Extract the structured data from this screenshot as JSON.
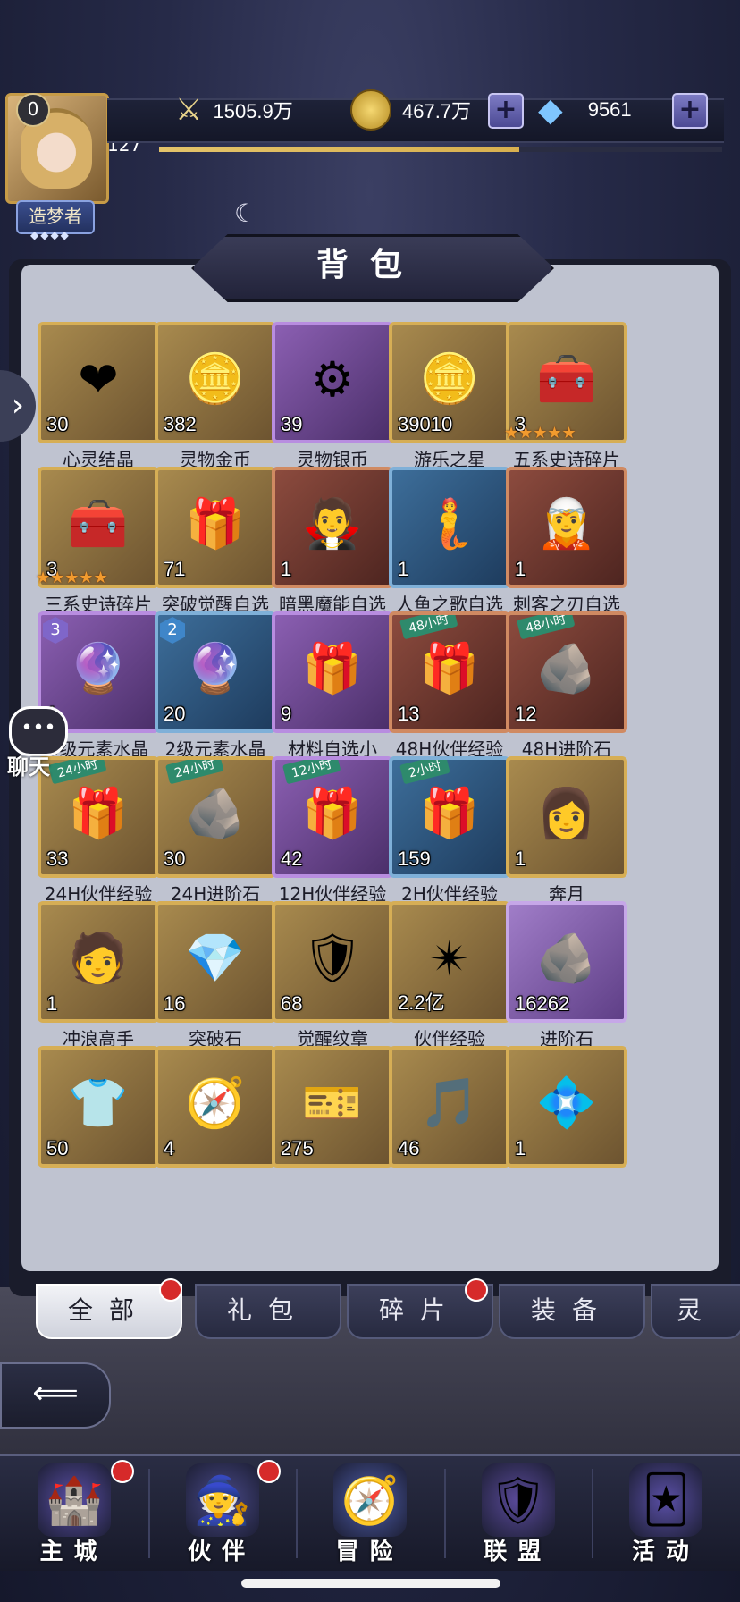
{
  "player": {
    "level_badge": "0",
    "level": "127",
    "title": "造梦者",
    "title_stars": "◆◆◆◆",
    "xp_fraction": 0.64
  },
  "resources": {
    "power": "1505.9万",
    "gold": "467.7万",
    "diamond": "9561"
  },
  "panel": {
    "title": "背包"
  },
  "items": [
    {
      "name": "心灵结晶",
      "qty": "30",
      "frame": "gold",
      "icon": "❤"
    },
    {
      "name": "灵物金币",
      "qty": "382",
      "frame": "gold",
      "icon": "🪙"
    },
    {
      "name": "灵物银币",
      "qty": "39",
      "frame": "purple",
      "icon": "⚙"
    },
    {
      "name": "游乐之星",
      "qty": "39010",
      "frame": "gold",
      "icon": "🪙"
    },
    {
      "name": "五系史诗碎片",
      "qty": "3",
      "frame": "gold",
      "icon": "🧰",
      "stars": "★★★★★"
    },
    {
      "name": "三系史诗碎片",
      "qty": "3",
      "frame": "gold",
      "icon": "🧰",
      "stars": "★★★★★"
    },
    {
      "name": "突破觉醒自选",
      "qty": "71",
      "frame": "gold",
      "icon": "🎁"
    },
    {
      "name": "暗黑魔能自选",
      "qty": "1",
      "frame": "red",
      "icon": "🧛"
    },
    {
      "name": "人鱼之歌自选",
      "qty": "1",
      "frame": "blue",
      "icon": "🧜"
    },
    {
      "name": "刺客之刃自选",
      "qty": "1",
      "frame": "red",
      "icon": "🧝"
    },
    {
      "name": "3级元素水晶",
      "qty": "1",
      "frame": "purple",
      "icon": "🔮",
      "tier": "3"
    },
    {
      "name": "2级元素水晶",
      "qty": "20",
      "frame": "blue",
      "icon": "🔮",
      "tier": "2"
    },
    {
      "name": "材料自选小",
      "qty": "9",
      "frame": "purple",
      "icon": "🎁"
    },
    {
      "name": "48H伙伴经验",
      "qty": "13",
      "frame": "red",
      "icon": "🎁",
      "tag": "48小时"
    },
    {
      "name": "48H进阶石",
      "qty": "12",
      "frame": "red",
      "icon": "🪨",
      "tag": "48小时"
    },
    {
      "name": "24H伙伴经验",
      "qty": "33",
      "frame": "gold",
      "icon": "🎁",
      "tag": "24小时"
    },
    {
      "name": "24H进阶石",
      "qty": "30",
      "frame": "gold",
      "icon": "🪨",
      "tag": "24小时"
    },
    {
      "name": "12H伙伴经验",
      "qty": "42",
      "frame": "purple",
      "icon": "🎁",
      "tag": "12小时"
    },
    {
      "name": "2H伙伴经验",
      "qty": "159",
      "frame": "blue",
      "icon": "🎁",
      "tag": "2小时"
    },
    {
      "name": "奔月",
      "qty": "1",
      "frame": "gold",
      "icon": "👩"
    },
    {
      "name": "冲浪高手",
      "qty": "1",
      "frame": "gold",
      "icon": "🧑"
    },
    {
      "name": "突破石",
      "qty": "16",
      "frame": "gold",
      "icon": "💎"
    },
    {
      "name": "觉醒纹章",
      "qty": "68",
      "frame": "gold",
      "icon": "🛡"
    },
    {
      "name": "伙伴经验",
      "qty": "2.2亿",
      "frame": "gold",
      "icon": "✴"
    },
    {
      "name": "进阶石",
      "qty": "16262",
      "frame": "lilac",
      "icon": "🪨"
    },
    {
      "name": "",
      "qty": "50",
      "frame": "gold",
      "icon": "👕"
    },
    {
      "name": "",
      "qty": "4",
      "frame": "gold",
      "icon": "🧭"
    },
    {
      "name": "",
      "qty": "275",
      "frame": "gold",
      "icon": "🎫"
    },
    {
      "name": "",
      "qty": "46",
      "frame": "gold",
      "icon": "🎵"
    },
    {
      "name": "",
      "qty": "1",
      "frame": "gold",
      "icon": "💠"
    }
  ],
  "tabs": [
    "全部",
    "礼包",
    "碎片",
    "装备",
    "灵"
  ],
  "back_label": "⟸",
  "side": {
    "chat": "聊天"
  },
  "nav": [
    "主城",
    "伙伴",
    "冒险",
    "联盟",
    "活动"
  ],
  "icons": {
    "power": "sword-icon",
    "gold": "coin-icon",
    "diamond": "diamond-icon",
    "plus": "plus-icon"
  }
}
